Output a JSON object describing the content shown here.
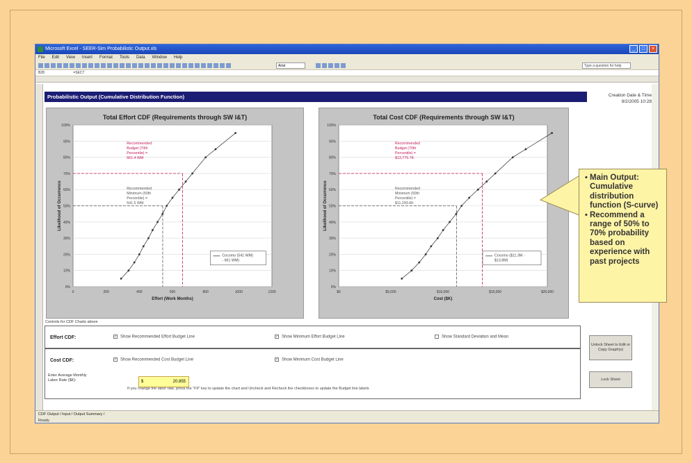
{
  "window": {
    "title": "Microsoft Excel - SEER-Sim Probabilistic Output.xls",
    "menu": [
      "File",
      "Edit",
      "View",
      "Insert",
      "Format",
      "Tools",
      "Data",
      "Window",
      "Help"
    ],
    "font_name": "Arial",
    "help_placeholder": "Type a question for help",
    "cell_ref": "B28",
    "formula": "=SEC7"
  },
  "sheet": {
    "banner": "Probabilistic Output (Cumulative Distribution Function)",
    "creation_label": "Creation Date & Time",
    "creation_value": "9/2/2005 10:28",
    "controls_label": "Controls for CDF Charts above",
    "effort_label": "Effort CDF:",
    "cost_label": "Cost CDF:",
    "effort_checks": [
      "Show Recommended Effort Budget Line",
      "Show Minimum Effort Budget Line",
      "Show Standard Deviation and Mean"
    ],
    "cost_checks": [
      "Show Recommended Cost Budget Line",
      "Show Minimum Cost Budget Line"
    ],
    "rate_label": "Enter Average Monthly Labor Rate ($K):",
    "rate_currency": "$",
    "rate_value": "20.855",
    "rate_note": "If you change the labor rate, press the \"F9\" key to update the chart and Uncheck and Recheck the checkboxes to update the Budget line labels",
    "unlock_button": "Unlock Sheet to Edit or Copy Graph(s)",
    "lock_button": "Lock Sheet",
    "tabs": "CDF Output / Input / Output Summary /",
    "status": "Ready"
  },
  "callout": {
    "items": [
      "Main Output: Cumulative distribution function (S-curve)",
      "Recommend  a range of 50% to 70% probability based on experience with past projects"
    ]
  },
  "chart_data": [
    {
      "type": "line",
      "title": "Total Effort CDF (Requirements through SW I&T)",
      "xlabel": "Effort (Work Months)",
      "ylabel": "Likelihood of Occurrence",
      "xlim": [
        0,
        1200
      ],
      "ylim": [
        0,
        100
      ],
      "x_ticks": [
        "0",
        "200",
        "400",
        "600",
        "800",
        "1000",
        "1200"
      ],
      "y_ticks": [
        "0%",
        "10%",
        "20%",
        "30%",
        "40%",
        "50%",
        "60%",
        "70%",
        "80%",
        "90%",
        "100%"
      ],
      "series": [
        {
          "name": "Cocomo (541 WM) - 661 WM)",
          "x": [
            290,
            335,
            370,
            400,
            425,
            455,
            480,
            510,
            540,
            565,
            600,
            640,
            680,
            720,
            800,
            860,
            980
          ],
          "y": [
            5,
            10,
            15,
            20,
            25,
            30,
            35,
            40,
            45,
            50,
            55,
            60,
            65,
            70,
            80,
            85,
            95
          ]
        }
      ],
      "reference_lines": [
        {
          "x": 661,
          "y": 70
        },
        {
          "x": 541,
          "y": 50
        }
      ],
      "annotations": [
        "Recommended Budget (70th Percentile) = 661.4 WM",
        "Recommended Minimum (50th Percentile) = 541.5 WM"
      ],
      "grid": true,
      "legend": "bottom-right"
    },
    {
      "type": "line",
      "title": "Total Cost CDF (Requirements through SW I&T)",
      "xlabel": "Cost ($K)",
      "ylabel": "Likelihood of Occurrence",
      "xlim": [
        0,
        20000
      ],
      "ylim": [
        0,
        100
      ],
      "x_ticks": [
        "$0",
        "$5,000",
        "$10,000",
        "$15,000",
        "$20,000"
      ],
      "y_ticks": [
        "0%",
        "10%",
        "20%",
        "30%",
        "40%",
        "50%",
        "60%",
        "70%",
        "80%",
        "90%",
        "100%"
      ],
      "series": [
        {
          "name": "Cocomo ($11.3M - $13.8M)",
          "x": [
            6050,
            6990,
            7720,
            8340,
            8860,
            9490,
            10010,
            10640,
            11260,
            11780,
            12510,
            13350,
            14180,
            15010,
            16680,
            17930,
            20440
          ],
          "y": [
            5,
            10,
            15,
            20,
            25,
            30,
            35,
            40,
            45,
            50,
            55,
            60,
            65,
            70,
            80,
            85,
            95
          ]
        }
      ],
      "reference_lines": [
        {
          "x": 13775,
          "y": 70
        },
        {
          "x": 11293,
          "y": 50
        }
      ],
      "annotations": [
        "Recommended Budget (70th Percentile) = $13,775.7K",
        "Recommended Minimum (50th Percentile) = $11,293.6K"
      ],
      "grid": true,
      "legend": "bottom-right"
    }
  ],
  "colors": {
    "page_bg": "#fbd397",
    "banner": "#1b1c73",
    "callout_bg": "#fef4a6",
    "budget_line": "#c2185b",
    "minimum_line": "#555555"
  }
}
